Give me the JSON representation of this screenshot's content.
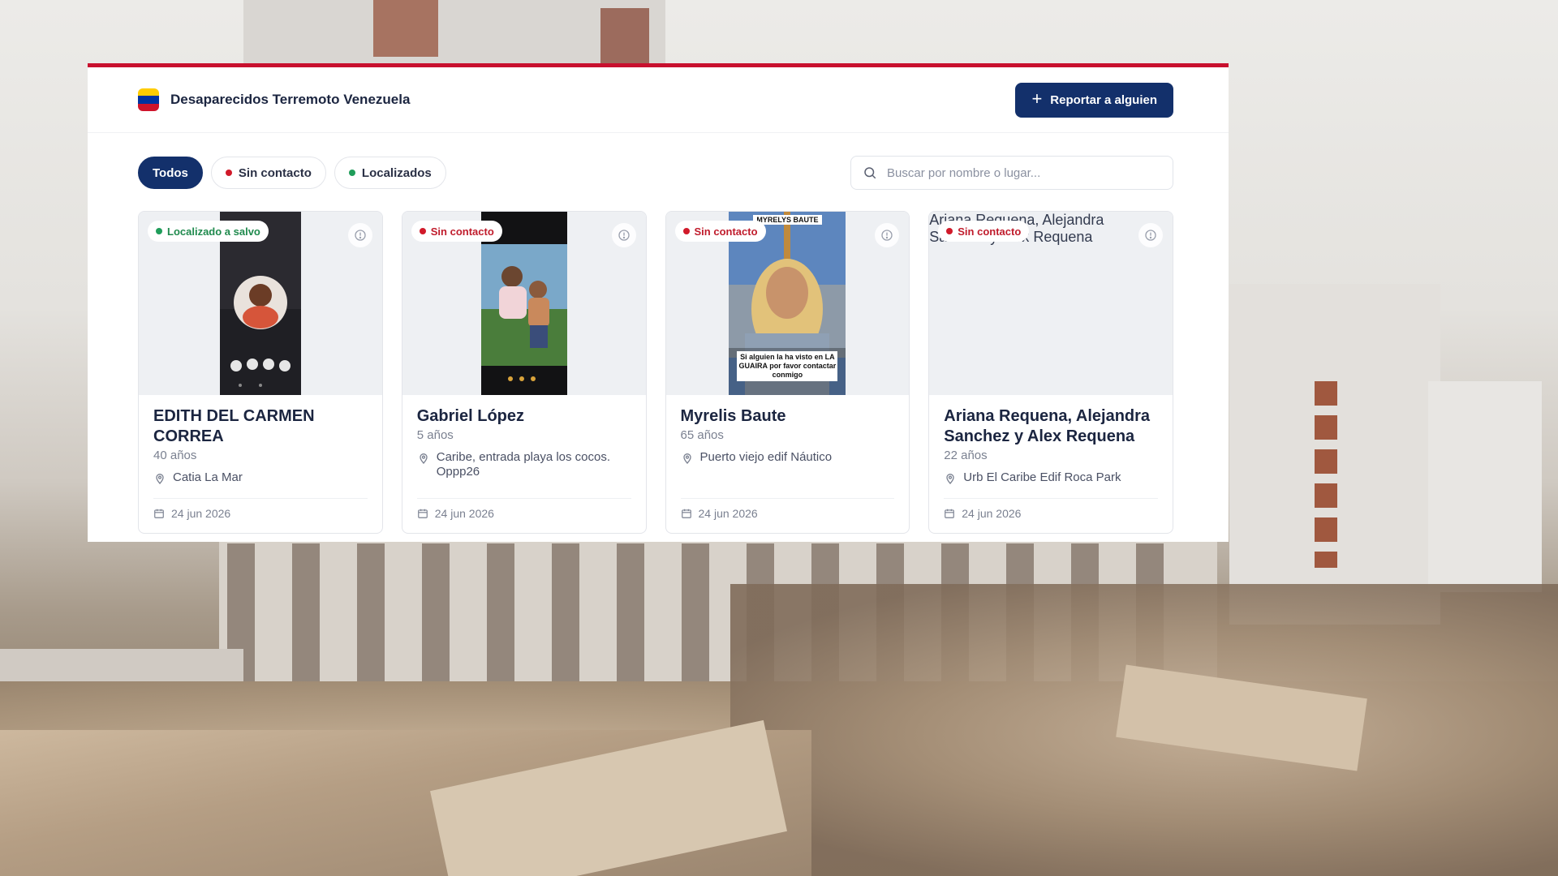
{
  "header": {
    "title": "Desaparecidos Terremoto Venezuela",
    "report_label": "Reportar a alguien",
    "flag_colors": [
      "#ffcc00",
      "#0033a0",
      "#cf142b"
    ]
  },
  "filters": [
    {
      "label": "Todos",
      "active": true
    },
    {
      "label": "Sin contacto",
      "dot": "#d11a2a"
    },
    {
      "label": "Localizados",
      "dot": "#1f9d5a"
    }
  ],
  "search": {
    "placeholder": "Buscar por nombre o lugar..."
  },
  "cards": [
    {
      "status": "Localizado a salvo",
      "status_type": "found",
      "name": "EDITH DEL CARMEN CORREA",
      "age": "40 años",
      "location": "Catia La Mar",
      "date": "24 jun 2026"
    },
    {
      "status": "Sin contacto",
      "status_type": "missing",
      "name": "Gabriel López",
      "age": "5 años",
      "location": "Caribe, entrada playa los cocos. Oppp26",
      "date": "24 jun 2026"
    },
    {
      "status": "Sin contacto",
      "status_type": "missing",
      "name": "Myrelis Baute",
      "age": "65 años",
      "location": "Puerto viejo edif Náutico",
      "date": "24 jun 2026",
      "photo_caption_top": "MYRELYS BAUTE",
      "photo_caption_bottom": "Si alguien la ha visto en LA GUAIRA por favor contactar conmigo"
    },
    {
      "status": "Sin contacto",
      "status_type": "missing",
      "name": "Ariana Requena, Alejandra Sanchez y Alex Requena",
      "age": "22 años",
      "location": "Urb El Caribe Edif Roca Park",
      "date": "24 jun 2026",
      "photo_alt": "Ariana Requena, Alejandra Sanchez y Alex Requena"
    }
  ],
  "accent": "#c8102e",
  "primary": "#13306b"
}
